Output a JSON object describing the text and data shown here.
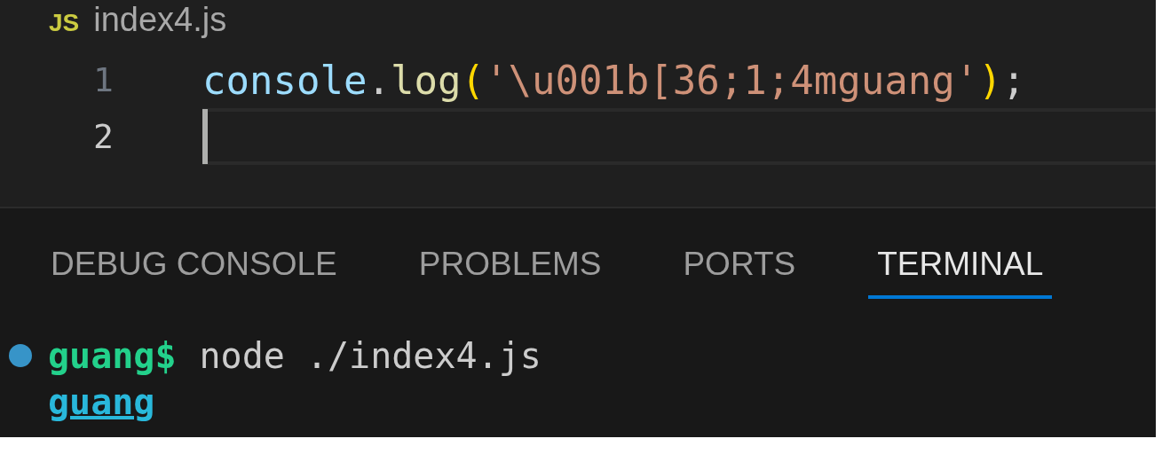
{
  "editor_tab": {
    "icon_text": "JS",
    "title": "index4.js"
  },
  "editor": {
    "lines": [
      {
        "number": "1",
        "current": false,
        "tokens": [
          {
            "kind": "variable",
            "text": "console"
          },
          {
            "kind": "punct",
            "text": "."
          },
          {
            "kind": "function",
            "text": "log"
          },
          {
            "kind": "bracket",
            "text": "("
          },
          {
            "kind": "string",
            "text": "'\\u001b[36;1;4mguang'"
          },
          {
            "kind": "bracket",
            "text": ")"
          },
          {
            "kind": "punct",
            "text": ";"
          }
        ]
      },
      {
        "number": "2",
        "current": true
      }
    ]
  },
  "panel_tabs": [
    {
      "label": "DEBUG CONSOLE",
      "selected": false
    },
    {
      "label": "PROBLEMS",
      "selected": false
    },
    {
      "label": "PORTS",
      "selected": false
    },
    {
      "label": "TERMINAL",
      "selected": true
    }
  ],
  "terminal": {
    "lines": [
      {
        "kind": "command",
        "decoration": true,
        "prompt": "guang$",
        "command": "node ./index4.js"
      },
      {
        "kind": "ansi-output",
        "text": "guang"
      }
    ]
  }
}
